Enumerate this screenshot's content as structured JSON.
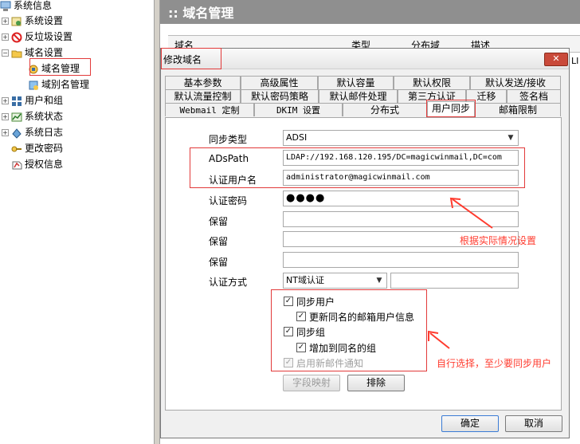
{
  "tree": {
    "items": [
      {
        "label": "系统信息",
        "icon": "computer-icon"
      },
      {
        "label": "系统设置",
        "icon": "settings-icon"
      },
      {
        "label": "反垃圾设置",
        "icon": "no-entry-icon"
      },
      {
        "label": "域名设置",
        "icon": "folder-icon"
      },
      {
        "label": "域名管理",
        "icon": "domain-icon"
      },
      {
        "label": "域别名管理",
        "icon": "domain-alias-icon"
      },
      {
        "label": "用户和组",
        "icon": "users-icon"
      },
      {
        "label": "系统状态",
        "icon": "status-icon"
      },
      {
        "label": "系统日志",
        "icon": "log-icon"
      },
      {
        "label": "更改密码",
        "icon": "key-icon"
      },
      {
        "label": "授权信息",
        "icon": "license-icon"
      }
    ]
  },
  "content": {
    "title": ":: 域名管理",
    "columns": [
      "域名",
      "类型",
      "分布域",
      "描述"
    ],
    "row_fragment": "LI"
  },
  "dialog": {
    "title": "修改域名",
    "tabs_row1": [
      "基本参数",
      "高级属性",
      "默认容量",
      "默认权限",
      "默认发送/接收"
    ],
    "tabs_row2": [
      "默认流量控制",
      "默认密码策略",
      "默认邮件处理",
      "第三方认证",
      "迁移",
      "签名档"
    ],
    "tabs_row3": [
      "Webmail 定制",
      "DKIM 设置",
      "分布式",
      "用户同步",
      "邮箱限制"
    ],
    "active_tab": "用户同步",
    "form": {
      "sync_type_label": "同步类型",
      "sync_type_value": "ADSI",
      "adspath_label": "ADsPath",
      "adspath_value": "LDAP://192.168.120.195/DC=magicwinmail,DC=com",
      "auth_user_label": "认证用户名",
      "auth_user_value": "administrator@magicwinmail.com",
      "auth_pwd_label": "认证密码",
      "auth_pwd_value": "●●●●",
      "reserved1_label": "保留",
      "reserved2_label": "保留",
      "reserved3_label": "保留",
      "auth_method_label": "认证方式",
      "auth_method_value": "NT域认证"
    },
    "checks": {
      "sync_user": "同步用户",
      "update_same_name": "更新同名的邮箱用户信息",
      "sync_group": "同步组",
      "add_to_group": "增加到同名的组",
      "enable_new_mail_notify": "启用新邮件通知"
    },
    "buttons": {
      "field_mapping": "字段映射",
      "exclude": "排除",
      "ok": "确定",
      "cancel": "取消"
    }
  },
  "annotations": {
    "note1": "根据实际情况设置",
    "note2": "自行选择，至少要同步用户"
  },
  "colors": {
    "annotation_red": "#ff3b2e",
    "header_gray": "#8f8f8f"
  }
}
